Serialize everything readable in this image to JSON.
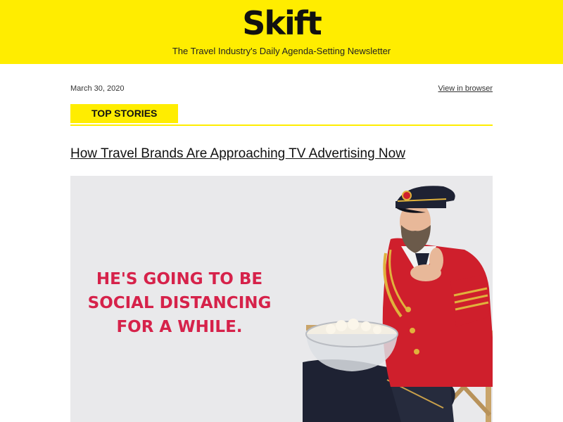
{
  "header": {
    "brand": "Skift",
    "tagline": "The Travel Industry's Daily Agenda-Setting Newsletter",
    "background": "#ffed00"
  },
  "meta": {
    "date": "March 30, 2020",
    "view_in_browser": "View in browser"
  },
  "section": {
    "label": "TOP STORIES"
  },
  "article": {
    "headline": "How Travel Brands Are Approaching TV Advertising Now",
    "image": {
      "caption_lines": [
        "HE'S GOING TO BE",
        "SOCIAL DISTANCING",
        "FOR A WHILE."
      ],
      "caption_color": "#d6224a",
      "subject": "captain-character-with-popcorn"
    }
  }
}
